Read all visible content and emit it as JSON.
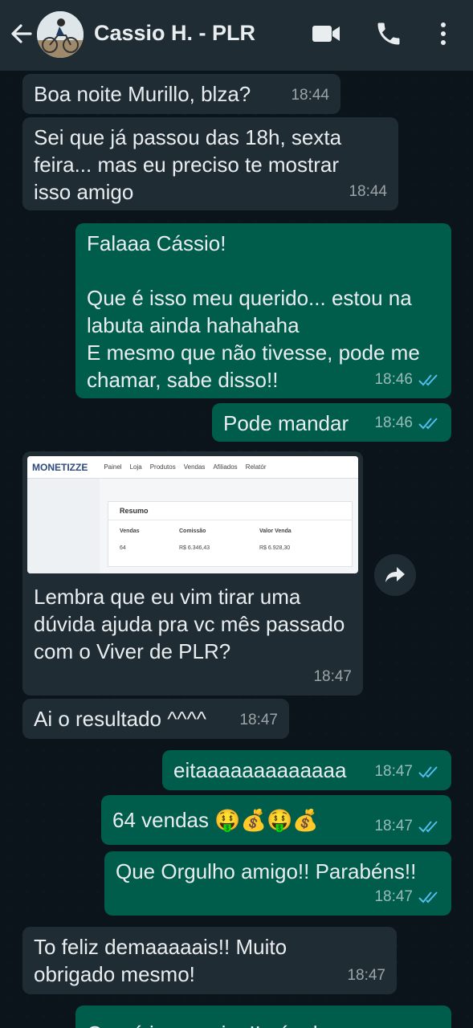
{
  "header": {
    "contact_name": "Cassio H. - PLR",
    "icons": [
      "back-arrow-icon",
      "video-call-icon",
      "phone-icon",
      "more-options-icon"
    ]
  },
  "messages": [
    {
      "direction": "in",
      "text": "Boa noite Murillo, blza?",
      "time": "18:44"
    },
    {
      "direction": "in",
      "text": "Sei que já passou das 18h, sexta feira... mas eu preciso te mostrar isso amigo",
      "time": "18:44"
    },
    {
      "direction": "out",
      "text": "Falaaa Cássio!\n\nQue é isso meu querido... estou na labuta ainda hahahaha\nE mesmo que não tivesse, pode me chamar, sabe disso!!",
      "time": "18:46",
      "status": "read"
    },
    {
      "direction": "out",
      "text": "Pode mandar",
      "time": "18:46",
      "status": "read"
    },
    {
      "direction": "in",
      "text": "Lembra que eu vim tirar uma dúvida ajuda pra vc mês passado com o Viver de PLR?",
      "time": "18:47",
      "image": {
        "logo": "MONETIZZE",
        "nav": [
          "Painel",
          "Loja",
          "Produtos",
          "Vendas",
          "Afiliados",
          "Relatór"
        ],
        "panel_title": "Resumo",
        "columns": [
          "Vendas",
          "Comissão",
          "Valor Venda"
        ],
        "values": [
          "64",
          "R$ 6.346,43",
          "R$ 6.928,30"
        ]
      }
    },
    {
      "direction": "in",
      "text": "Ai o resultado ^^^^",
      "time": "18:47"
    },
    {
      "direction": "out",
      "text": "eitaaaaaaaaaaaaa",
      "time": "18:47",
      "status": "read"
    },
    {
      "direction": "out",
      "text": "64 vendas 🤑💰🤑💰",
      "time": "18:47",
      "status": "read"
    },
    {
      "direction": "out",
      "text": "Que Orgulho amigo!! Parabéns!!",
      "time": "18:47",
      "status": "read"
    },
    {
      "direction": "in",
      "text": "To feliz demaaaaais!! Muito obrigado mesmo!",
      "time": "18:47"
    },
    {
      "direction": "out",
      "text": "Que é isso amigo!! nós demos",
      "time": ""
    }
  ]
}
